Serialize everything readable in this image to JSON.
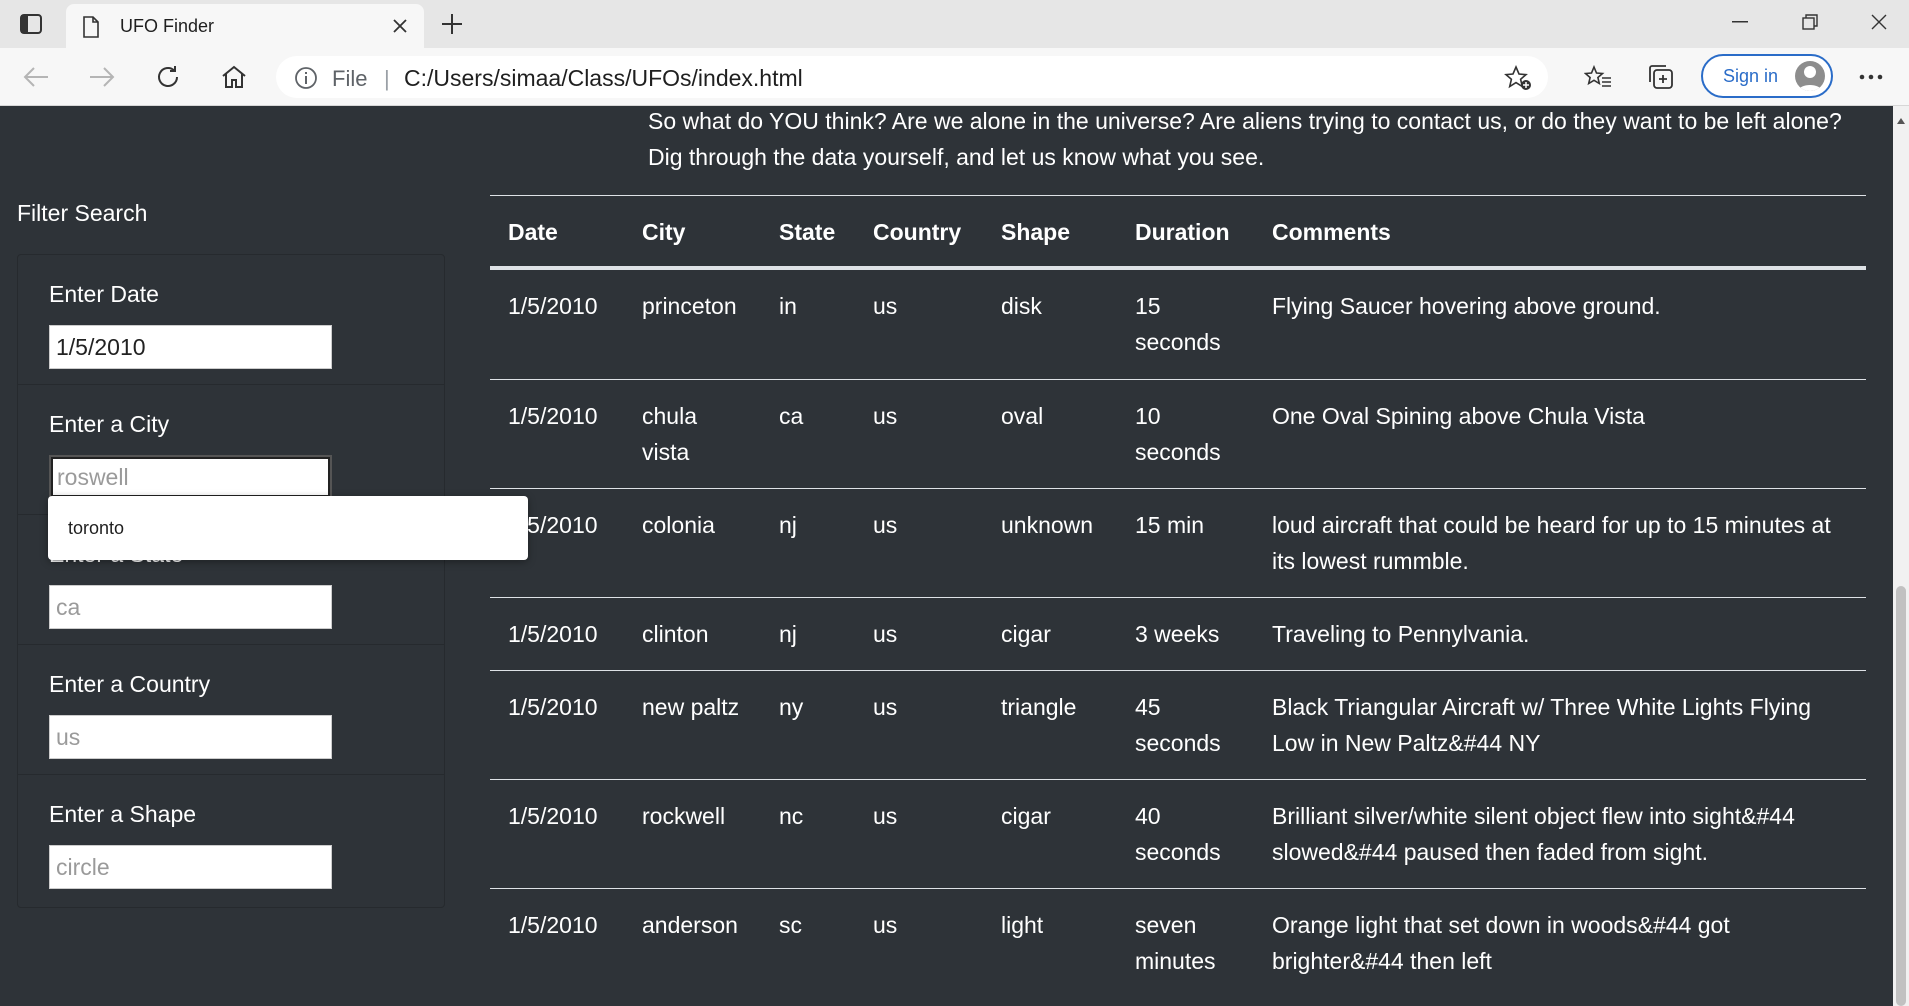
{
  "browser": {
    "tab_title": "UFO Finder",
    "address_scheme": "File",
    "address_url": "C:/Users/simaa/Class/UFOs/index.html",
    "sign_in_label": "Sign in"
  },
  "intro_text": "So what do YOU think? Are we alone in the universe? Are aliens trying to contact us, or do they want to be left alone? Dig through the data yourself, and let us know what you see.",
  "filters": {
    "title": "Filter Search",
    "items": [
      {
        "label": "Enter Date",
        "value": "1/5/2010",
        "placeholder": ""
      },
      {
        "label": "Enter a City",
        "value": "",
        "placeholder": "roswell"
      },
      {
        "label": "Enter a State",
        "value": "",
        "placeholder": "ca"
      },
      {
        "label": "Enter a Country",
        "value": "",
        "placeholder": "us"
      },
      {
        "label": "Enter a Shape",
        "value": "",
        "placeholder": "circle"
      }
    ],
    "autocomplete_suggestion": "toronto"
  },
  "table": {
    "headers": [
      "Date",
      "City",
      "State",
      "Country",
      "Shape",
      "Duration",
      "Comments"
    ],
    "rows": [
      {
        "date": "1/5/2010",
        "city": "princeton",
        "state": "in",
        "country": "us",
        "shape": "disk",
        "duration": "15 seconds",
        "comments": "Flying Saucer hovering above ground."
      },
      {
        "date": "1/5/2010",
        "city": "chula vista",
        "state": "ca",
        "country": "us",
        "shape": "oval",
        "duration": "10 seconds",
        "comments": "One Oval Spining above Chula Vista"
      },
      {
        "date": "1/5/2010",
        "city": "colonia",
        "state": "nj",
        "country": "us",
        "shape": "unknown",
        "duration": "15 min",
        "comments": "loud aircraft that could be heard for up to 15 minutes at its lowest rummble."
      },
      {
        "date": "1/5/2010",
        "city": "clinton",
        "state": "nj",
        "country": "us",
        "shape": "cigar",
        "duration": "3 weeks",
        "comments": "Traveling to Pennylvania."
      },
      {
        "date": "1/5/2010",
        "city": "new paltz",
        "state": "ny",
        "country": "us",
        "shape": "triangle",
        "duration": "45 seconds",
        "comments": "Black Triangular Aircraft w/ Three White Lights Flying Low in New Paltz&#44 NY"
      },
      {
        "date": "1/5/2010",
        "city": "rockwell",
        "state": "nc",
        "country": "us",
        "shape": "cigar",
        "duration": "40 seconds",
        "comments": "Brilliant silver/white silent object flew into sight&#44 slowed&#44 paused then faded from sight."
      },
      {
        "date": "1/5/2010",
        "city": "anderson",
        "state": "sc",
        "country": "us",
        "shape": "light",
        "duration": "seven minutes",
        "comments": "Orange light that set down in woods&#44 got brighter&#44 then left"
      }
    ]
  },
  "colors": {
    "page_bg": "#2e3338",
    "accent": "#2a6cc8"
  }
}
